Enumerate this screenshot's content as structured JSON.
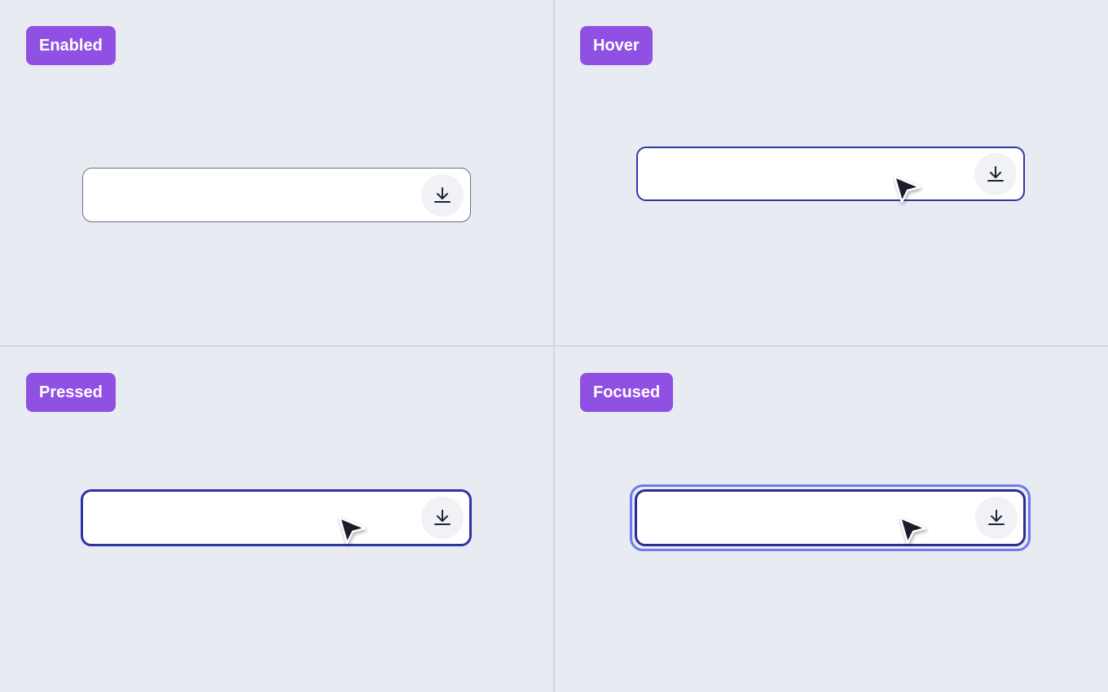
{
  "states": [
    {
      "id": "enabled",
      "label": "Enabled"
    },
    {
      "id": "hover",
      "label": "Hover"
    },
    {
      "id": "pressed",
      "label": "Pressed"
    },
    {
      "id": "focused",
      "label": "Focused"
    }
  ],
  "field": {
    "value": "",
    "trailing_icon": "download-icon"
  },
  "colors": {
    "background": "#E8EBF2",
    "badge": "#9150E4",
    "badge_text": "#FFFFFF",
    "border_enabled": "#6B6C86",
    "border_active": "#2E33A3",
    "focus_ring": "#6B7AF0",
    "icon": "#1F2233",
    "icon_button_bg": "#F1F2F5"
  }
}
